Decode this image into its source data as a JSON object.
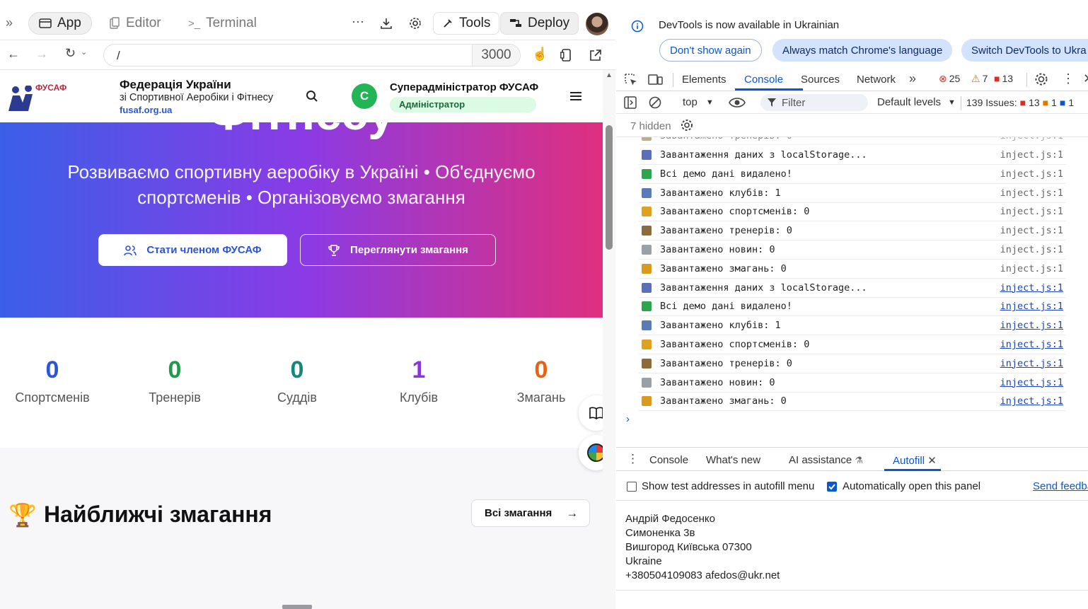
{
  "browser": {
    "tabs": {
      "app": "App",
      "editor": "Editor",
      "terminal": "Terminal"
    },
    "tools_label": "Tools",
    "deploy_label": "Deploy",
    "url": "/",
    "port": "3000"
  },
  "site": {
    "logo_text": "ФУСАФ",
    "org_name_line1": "Федерація України",
    "org_name_line2": "зі Спортивної Аеробіки і Фітнесу",
    "org_url": "fusaf.org.ua",
    "user_initial": "С",
    "user_name": "Суперадміністратор ФУСАФ",
    "user_role": "Адміністратор",
    "hero_title_cut": "Фітнесу",
    "hero_subtitle": "Розвиваємо спортивну аеробіку в Україні • Об'єднуємо спортсменів • Організовуємо змагання",
    "btn_member": "Стати членом ФУСАФ",
    "btn_competitions": "Переглянути змагання",
    "stats": [
      {
        "value": "0",
        "label": "Спортсменів",
        "color": "#2a55d8"
      },
      {
        "value": "0",
        "label": "Тренерів",
        "color": "#1f9a4a"
      },
      {
        "value": "0",
        "label": "Суддів",
        "color": "#13897a"
      },
      {
        "value": "1",
        "label": "Клубів",
        "color": "#8b34e0"
      },
      {
        "value": "0",
        "label": "Змагань",
        "color": "#e8620f"
      }
    ],
    "section_title": "Найближчі змагання",
    "all_competitions": "Всі змагання"
  },
  "devtools": {
    "info_text": "DevTools is now available in Ukrainian",
    "btn_dont_show": "Don't show again",
    "btn_always_match": "Always match Chrome's language",
    "btn_switch": "Switch DevTools to Ukra",
    "tabs": {
      "elements": "Elements",
      "console": "Console",
      "sources": "Sources",
      "network": "Network"
    },
    "errors": "25",
    "warnings": "7",
    "issues_count": "13",
    "context": "top",
    "filter_placeholder": "Filter",
    "levels": "Default levels",
    "issues_label": "139 Issues:",
    "issues_err": "13",
    "issues_warn": "1",
    "issues_info": "1",
    "hidden": "7 hidden",
    "logs": [
      {
        "icon": "chart",
        "text": "Завантаження даних з localStorage...",
        "src": "inject.js:1",
        "link": false
      },
      {
        "icon": "check",
        "text": "Всі демо дані видалено!",
        "src": "inject.js:1",
        "link": false
      },
      {
        "icon": "building",
        "text": "Завантажено клубів: 1",
        "src": "inject.js:1",
        "link": false
      },
      {
        "icon": "runner",
        "text": "Завантажено спортсменів: 0",
        "src": "inject.js:1",
        "link": false
      },
      {
        "icon": "coach",
        "text": "Завантажено тренерів: 0",
        "src": "inject.js:1",
        "link": false
      },
      {
        "icon": "news",
        "text": "Завантажено новин: 0",
        "src": "inject.js:1",
        "link": false
      },
      {
        "icon": "trophy",
        "text": "Завантажено змагань: 0",
        "src": "inject.js:1",
        "link": false
      },
      {
        "icon": "chart",
        "text": "Завантаження даних з localStorage...",
        "src": "inject.js:1",
        "link": true
      },
      {
        "icon": "check",
        "text": "Всі демо дані видалено!",
        "src": "inject.js:1",
        "link": true
      },
      {
        "icon": "building",
        "text": "Завантажено клубів: 1",
        "src": "inject.js:1",
        "link": true
      },
      {
        "icon": "runner",
        "text": "Завантажено спортсменів: 0",
        "src": "inject.js:1",
        "link": true
      },
      {
        "icon": "coach",
        "text": "Завантажено тренерів: 0",
        "src": "inject.js:1",
        "link": true
      },
      {
        "icon": "news",
        "text": "Завантажено новин: 0",
        "src": "inject.js:1",
        "link": true
      },
      {
        "icon": "trophy",
        "text": "Завантажено змагань: 0",
        "src": "inject.js:1",
        "link": true
      }
    ],
    "drawer": {
      "console": "Console",
      "whats_new": "What's new",
      "ai": "AI assistance",
      "autofill": "Autofill"
    },
    "autofill": {
      "show_test": "Show test addresses in autofill menu",
      "auto_open": "Automatically open this panel",
      "send_feedback": "Send feedba",
      "address": [
        "Андрій Федосенко",
        "Симоненка 3в",
        "Вишгород Київська 07300",
        "Ukraine",
        "+380504109083 afedos@ukr.net"
      ]
    }
  }
}
